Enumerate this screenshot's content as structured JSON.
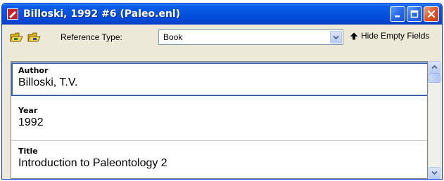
{
  "window": {
    "title": "Billoski, 1992 #6 (Paleo.enl)"
  },
  "titlebar_buttons": {
    "minimize": "minimize-icon",
    "maximize": "maximize-icon",
    "close": "close-icon"
  },
  "toolbar": {
    "icon_1": "folder-open-icon",
    "icon_2": "folder-open-icon",
    "reference_type_label": "Reference Type:",
    "reference_type_value": "Book",
    "hide_empty_label": "Hide Empty Fields"
  },
  "fields": [
    {
      "label": "Author",
      "value": "Billoski, T.V."
    },
    {
      "label": "Year",
      "value": "1992"
    },
    {
      "label": "Title",
      "value": "Introduction to Paleontology 2"
    }
  ],
  "colors": {
    "titlebar": "#0553e0",
    "window_bg": "#ece9d8",
    "active_field_border": "#3b62a8"
  }
}
